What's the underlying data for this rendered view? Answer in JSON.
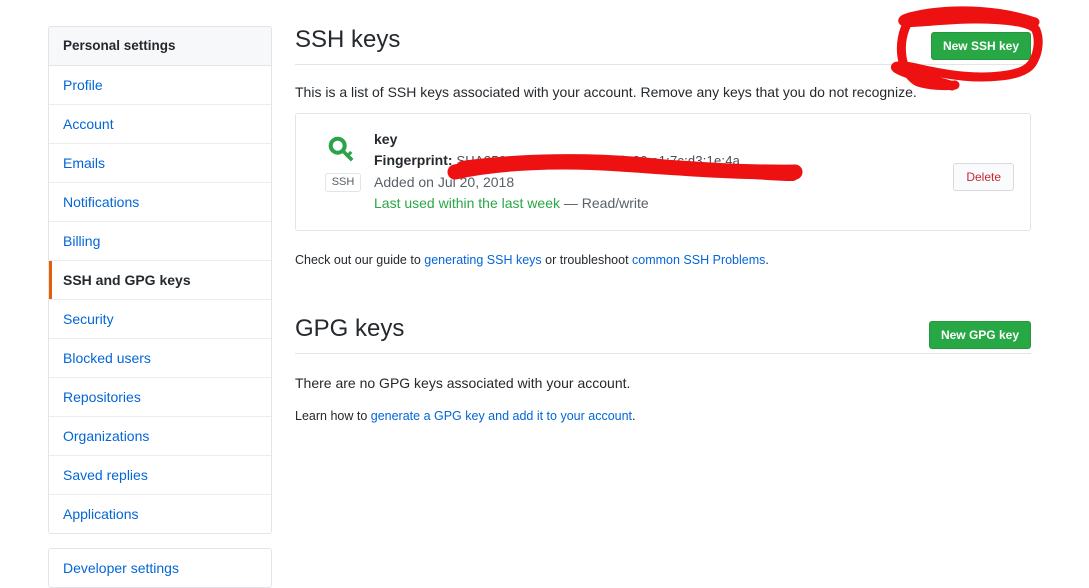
{
  "sidebar": {
    "header": "Personal settings",
    "items": [
      {
        "label": "Profile",
        "selected": false
      },
      {
        "label": "Account",
        "selected": false
      },
      {
        "label": "Emails",
        "selected": false
      },
      {
        "label": "Notifications",
        "selected": false
      },
      {
        "label": "Billing",
        "selected": false
      },
      {
        "label": "SSH and GPG keys",
        "selected": true
      },
      {
        "label": "Security",
        "selected": false
      },
      {
        "label": "Blocked users",
        "selected": false
      },
      {
        "label": "Repositories",
        "selected": false
      },
      {
        "label": "Organizations",
        "selected": false
      },
      {
        "label": "Saved replies",
        "selected": false
      },
      {
        "label": "Applications",
        "selected": false
      }
    ],
    "developer_settings": "Developer settings"
  },
  "ssh_section": {
    "title": "SSH keys",
    "new_key_button": "New SSH key",
    "description": "This is a list of SSH keys associated with your account. Remove any keys that you do not recognize.",
    "key": {
      "badge": "SSH",
      "title": "key",
      "fingerprint_label": "Fingerprint:",
      "fingerprint_value": "SHA256:ed:f9:48:b8:fc:54:9b:26:a1:7c:d3:1e:4a",
      "added": "Added on Jul 20, 2018",
      "last_used": "Last used within the last week",
      "access": "— Read/write",
      "delete_button": "Delete"
    },
    "guide": {
      "prefix": "Check out our guide to ",
      "link1": "generating SSH keys",
      "middle": " or troubleshoot ",
      "link2": "common SSH Problems",
      "suffix": "."
    }
  },
  "gpg_section": {
    "title": "GPG keys",
    "new_key_button": "New GPG key",
    "empty_message": "There are no GPG keys associated with your account.",
    "learn": {
      "prefix": "Learn how to ",
      "link": "generate a GPG key and add it to your account",
      "suffix": "."
    }
  },
  "annotation": {
    "color": "#ee1111",
    "circle_target": "New SSH key",
    "redaction_target": "fingerprint"
  },
  "colors": {
    "green_button": "#28a745",
    "link_blue": "#0366d6",
    "selected_orange": "#e36209",
    "delete_red": "#cb2431",
    "annotation_red": "#ee1111"
  }
}
